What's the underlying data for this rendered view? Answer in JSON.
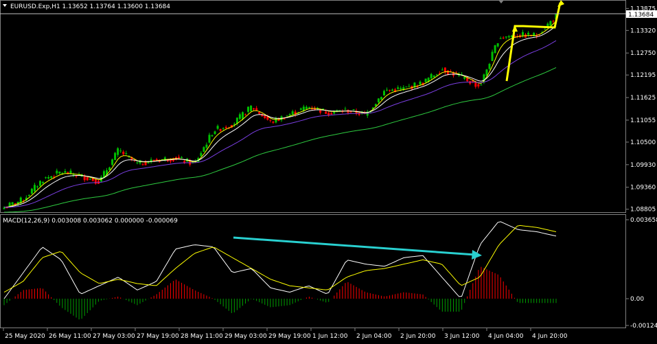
{
  "main_panel": {
    "header": "EURUSD.Exp,H1  1.13652 1.13764 1.13600 1.13684",
    "current_price": "1.13684"
  },
  "macd_panel": {
    "header": "MACD(12,26,9) 0.003008 0.003062 0.000000 -0.000069"
  },
  "chart_data": [
    {
      "type": "candlestick",
      "symbol": "EURUSD.Exp",
      "timeframe": "H1",
      "ohlc_last": {
        "open": 1.13652,
        "high": 1.13764,
        "low": 1.136,
        "close": 1.13684
      },
      "y_ticks": [
        "1.13875",
        "1.13320",
        "1.12750",
        "1.12195",
        "1.11625",
        "1.11055",
        "1.10500",
        "1.09930",
        "1.09360",
        "1.08805"
      ],
      "ylim": [
        1.088,
        1.1395
      ],
      "x_ticks": [
        "25 May 2020",
        "26 May 11:00",
        "27 May 03:00",
        "27 May 19:00",
        "28 May 11:00",
        "29 May 03:00",
        "29 May 19:00",
        "1 Jun 12:00",
        "2 Jun 04:00",
        "2 Jun 20:00",
        "3 Jun 12:00",
        "4 Jun 04:00",
        "4 Jun 20:00"
      ],
      "close_path": [
        1.0885,
        1.0905,
        1.0955,
        1.0975,
        1.0965,
        1.095,
        1.103,
        1.0995,
        1.1005,
        1.101,
        1.0995,
        1.108,
        1.1095,
        1.114,
        1.11,
        1.112,
        1.114,
        1.1125,
        1.113,
        1.112,
        1.118,
        1.1185,
        1.12,
        1.1235,
        1.1215,
        1.119,
        1.1315,
        1.132,
        1.132,
        1.1368
      ],
      "series": [
        {
          "name": "",
          "color": "#ffff00"
        },
        {
          "name": "",
          "color": "#ffffff"
        },
        {
          "name": "",
          "color": "#7b3fe4"
        },
        {
          "name": "",
          "color": "#2ecc40"
        }
      ],
      "colors": {
        "bull": "#00c000",
        "bear": "#ff0000"
      }
    },
    {
      "type": "histogram+line",
      "indicator": "MACD(12,26,9)",
      "values": [
        0.003008,
        0.003062,
        0.0,
        -6.9e-05
      ],
      "y_ticks": [
        "0.003658",
        "0.00",
        "-0.00124"
      ],
      "ylim": [
        -0.00124,
        0.003658
      ],
      "macd_path": [
        0.0,
        0.0012,
        0.0024,
        0.0018,
        0.0002,
        0.0006,
        0.001,
        0.0004,
        0.0008,
        0.0023,
        0.0025,
        0.0024,
        0.0012,
        0.0014,
        0.0005,
        0.0003,
        0.0006,
        0.0002,
        0.0018,
        0.0016,
        0.0015,
        0.0019,
        0.002,
        0.001,
        0.0,
        0.0025,
        0.0036,
        0.0032,
        0.0031,
        0.0029
      ],
      "signal_path": [
        0.0003,
        0.0008,
        0.0019,
        0.0022,
        0.0012,
        0.0007,
        0.0009,
        0.0007,
        0.0006,
        0.0014,
        0.0021,
        0.0024,
        0.0019,
        0.0014,
        0.0009,
        0.0006,
        0.0005,
        0.0004,
        0.001,
        0.0013,
        0.0014,
        0.0016,
        0.0018,
        0.0016,
        0.0006,
        0.001,
        0.0025,
        0.0034,
        0.0033,
        0.0031
      ]
    }
  ]
}
